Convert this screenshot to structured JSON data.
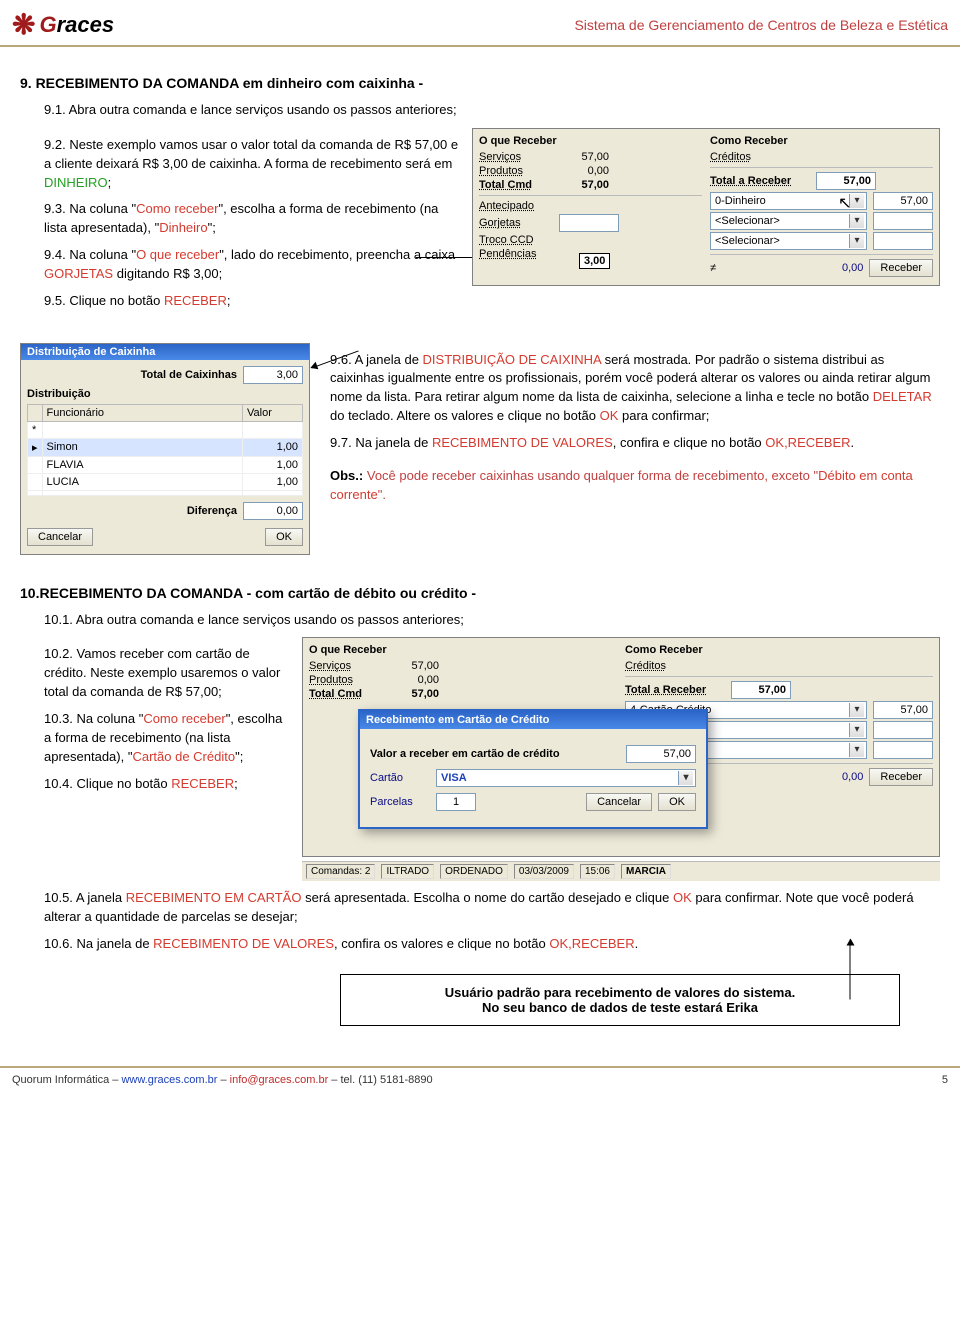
{
  "header": {
    "logo_word": "Graces",
    "title": "Sistema de Gerenciamento de Centros de Beleza e Estética"
  },
  "section9": {
    "heading": "9. RECEBIMENTO DA COMANDA em dinheiro com caixinha -",
    "i1_idx": "9.1.",
    "i1_txt": "Abra outra comanda e lance serviços usando os passos anteriores;",
    "i2_idx": "9.2.",
    "i2_pre": "Neste exemplo vamos usar o valor total da comanda de R$ 57,00 e a cliente deixará R$ 3,00 de caixinha. A forma de recebimento será em ",
    "i2_d": "DINHEIRO",
    "i2_post": ";",
    "i3_idx": "9.3.",
    "i3_pre": "Na coluna \"",
    "i3_cr": "Como receber",
    "i3_mid": "\", escolha a forma de recebimento (na lista apresentada), \"",
    "i3_din": "Dinheiro",
    "i3_post": "\";",
    "i4_idx": "9.4.",
    "i4_pre": "Na coluna \"",
    "i4_oqr": "O que receber",
    "i4_mid": "\", lado do recebimento, preencha a caixa ",
    "i4_gor": "GORJETAS",
    "i4_post": " digitando R$ 3,00;",
    "i5_idx": "9.5.",
    "i5_pre": "Clique no botão ",
    "i5_rec": "RECEBER",
    "i5_post": ";",
    "i6_idx": "9.6.",
    "i6_pre": "A janela de ",
    "i6_dc": "DISTRIBUIÇÃO DE CAIXINHA",
    "i6_mid": " será mostrada. Por padrão o sistema distribui as caixinhas igualmente entre os profissionais, porém você poderá alterar os valores ou ainda retirar algum nome da lista. Para retirar algum nome da lista de caixinha, selecione a linha e tecle no botão ",
    "i6_del": "DELETAR",
    "i6_mid2": " do teclado. Altere os valores e clique no botão ",
    "i6_ok": "OK",
    "i6_post": " para confirmar;",
    "i7_idx": "9.7.",
    "i7_pre": "Na janela de ",
    "i7_rv": "RECEBIMENTO DE VALORES",
    "i7_mid": ", confira e clique no botão ",
    "i7_okr": "OK,RECEBER",
    "i7_post": ".",
    "obs_label": "Obs.:",
    "obs_txt": " Você pode receber caixinhas usando qualquer forma de recebimento, exceto \"",
    "obs_red": "Débito em conta corrente",
    "obs_post": "\"."
  },
  "panel_receber": {
    "colA_title": "O que Receber",
    "servicos": "Serviços",
    "servicos_v": "57,00",
    "produtos": "Produtos",
    "produtos_v": "0,00",
    "total": "Total Cmd",
    "total_v": "57,00",
    "antecip": "Antecipado",
    "gorjetas": "Gorjetas",
    "troco": "Troco CCD",
    "pend": "Pendências",
    "tip": "3,00",
    "colB_title": "Como Receber",
    "creditos": "Créditos",
    "total_rec": "Total a Receber",
    "total_rec_v": "57,00",
    "forma": "0-Dinheiro",
    "forma_v": "57,00",
    "sel": "<Selecionar>",
    "diff": "≠",
    "diff_v": "0,00",
    "btn_receber": "Receber"
  },
  "dist_panel": {
    "title": "Distribuição de Caixinha",
    "total_lbl": "Total de Caixinhas",
    "total_v": "3,00",
    "dist_lbl": "Distribuição",
    "col_func": "Funcionário",
    "col_valor": "Valor",
    "rows": [
      {
        "n": "Simon",
        "v": "1,00"
      },
      {
        "n": "FLAVIA",
        "v": "1,00"
      },
      {
        "n": "LUCIA",
        "v": "1,00"
      }
    ],
    "dif_lbl": "Diferença",
    "dif_v": "0,00",
    "btn_cancel": "Cancelar",
    "btn_ok": "OK"
  },
  "section10": {
    "heading": "10.RECEBIMENTO DA COMANDA - com cartão de débito ou crédito -",
    "i1_idx": "10.1.",
    "i1_txt": "Abra outra comanda e lance serviços usando os passos anteriores;",
    "i2_idx": "10.2.",
    "i2_txt": "Vamos receber com cartão de crédito. Neste exemplo usaremos o valor total da comanda de R$ 57,00;",
    "i3_idx": "10.3.",
    "i3_pre": "Na coluna \"",
    "i3_cr": "Como receber",
    "i3_mid": "\", escolha a forma de recebimento (na lista apresentada), \"",
    "i3_cc": "Cartão de Crédito",
    "i3_post": "\";",
    "i4_idx": "10.4.",
    "i4_pre": "Clique no botão ",
    "i4_rec": "RECEBER",
    "i4_post": ";",
    "i5_idx": "10.5.",
    "i5_pre": "A janela ",
    "i5_rc": "RECEBIMENTO EM CARTÃO",
    "i5_mid": " será apresentada. Escolha o nome do cartão desejado e clique ",
    "i5_ok": "OK",
    "i5_post": " para confirmar. Note que você poderá alterar a quantidade de parcelas se desejar;",
    "i6_idx": "10.6.",
    "i6_pre": "Na janela de ",
    "i6_rv": "RECEBIMENTO DE VALORES",
    "i6_mid": ", confira os valores e clique no botão ",
    "i6_okr": "OK,RECEBER",
    "i6_post": "."
  },
  "panel_receber2": {
    "forma": "4-Cartão Crédito",
    "forma_v": "57,00"
  },
  "cc_dialog": {
    "title": "Recebimento em Cartão de Crédito",
    "valor_lbl": "Valor a receber em cartão de crédito",
    "valor_v": "57,00",
    "cartao_lbl": "Cartão",
    "cartao_v": "VISA",
    "parcelas_lbl": "Parcelas",
    "parcelas_v": "1",
    "btn_cancel": "Cancelar",
    "btn_ok": "OK"
  },
  "statusbar": {
    "cmd": "Comandas: 2",
    "flt": "ILTRADO",
    "ord": "ORDENADO",
    "date": "03/03/2009",
    "time": "15:06",
    "user": "MARCIA"
  },
  "note": {
    "l1": "Usuário padrão para recebimento de valores do sistema.",
    "l2": "No seu banco de dados de teste estará Erika"
  },
  "footer": {
    "left_pre": "Quorum Informática – ",
    "url1": "www.graces.com.br",
    "mid": " – ",
    "email": "info@graces.com.br",
    "post": " – tel. (11) 5181-8890",
    "page": "5"
  }
}
